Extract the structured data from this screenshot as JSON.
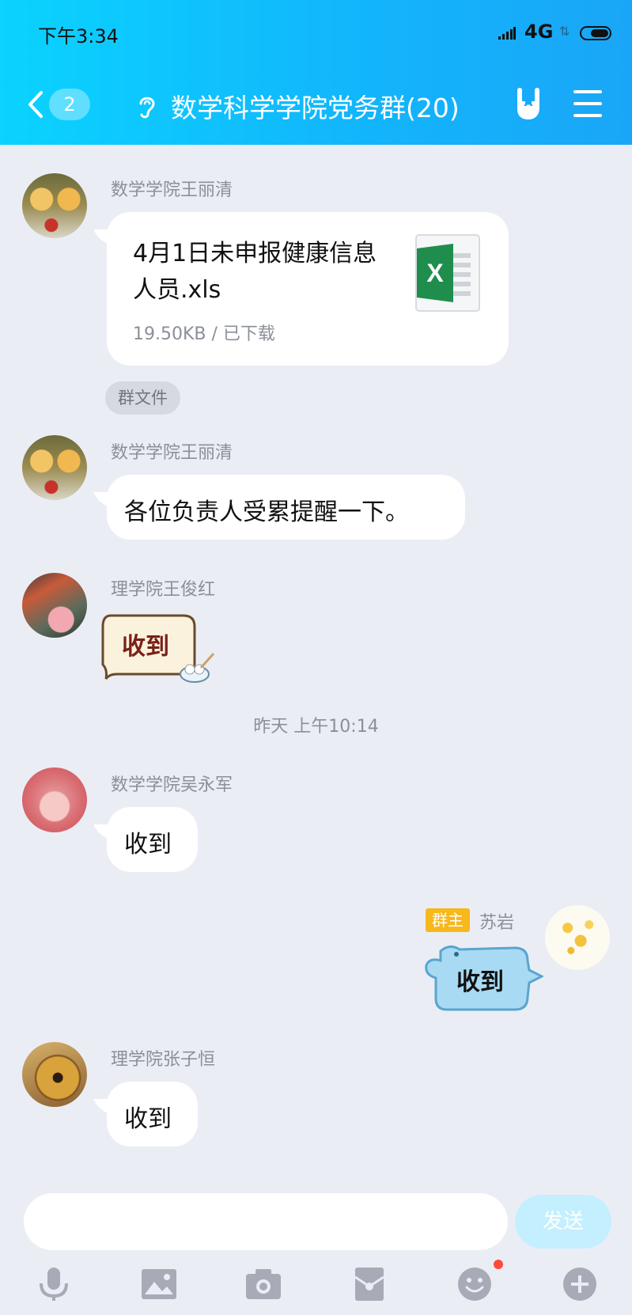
{
  "status_bar": {
    "time": "下午3:34",
    "network": "4G"
  },
  "header": {
    "back_count": "2",
    "title": "数学科学学院党务群(20)"
  },
  "messages": [
    {
      "sender": "数学学院王丽清",
      "file_name": "4月1日未申报健康信息人员.xls",
      "file_meta": "19.50KB / 已下载",
      "tag": "群文件"
    },
    {
      "sender": "数学学院王丽清",
      "text": "各位负责人受累提醒一下。"
    },
    {
      "sender": "理学院王俊红",
      "sticker_text": "收到"
    },
    {
      "sender": "数学学院吴永军",
      "text": "收到"
    },
    {
      "sender": "苏岩",
      "role": "群主",
      "sticker_text": "收到"
    },
    {
      "sender": "理学院张子恒",
      "text": "收到"
    }
  ],
  "timestamp": "昨天 上午10:14",
  "input": {
    "placeholder": "",
    "send_label": "发送"
  },
  "colors": {
    "header_start": "#0ad3ff",
    "header_end": "#1aa6f8",
    "background": "#ebedf5",
    "owner_badge": "#f6b81b",
    "send_button": "#c4efff"
  },
  "toolbar_icons": [
    "microphone-icon",
    "image-icon",
    "camera-icon",
    "red-packet-icon",
    "emoji-icon",
    "plus-icon"
  ]
}
